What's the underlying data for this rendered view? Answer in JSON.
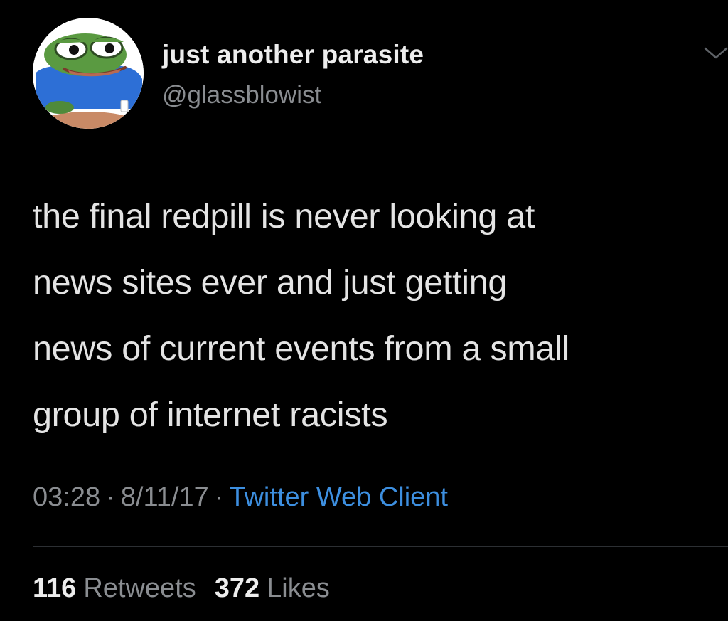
{
  "user": {
    "display_name": "just another parasite",
    "handle": "@glassblowist",
    "avatar_icon": "frog-avatar-icon"
  },
  "menu": {
    "icon": "chevron-down-icon"
  },
  "tweet": {
    "lines": [
      "the final redpill is never looking at",
      "news sites ever and just getting",
      "news of current events from a small",
      "group of internet racists"
    ],
    "time": "03:28",
    "date": "8/11/17",
    "separator": "·",
    "client": "Twitter Web Client"
  },
  "stats": {
    "retweets_count": "116",
    "retweets_label": "Retweets",
    "likes_count": "372",
    "likes_label": "Likes"
  },
  "colors": {
    "background": "#000000",
    "text": "#e4e4e4",
    "muted": "#8a8d91",
    "link": "#3d8fe0"
  }
}
